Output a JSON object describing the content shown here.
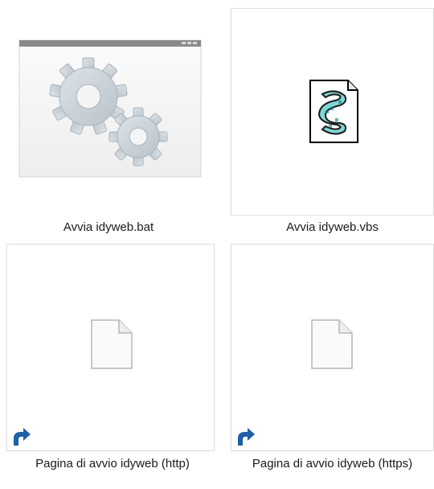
{
  "files": [
    {
      "name": "Avvia idyweb.bat",
      "icon": "batch-file-gears-icon"
    },
    {
      "name": "Avvia idyweb.vbs",
      "icon": "vbscript-file-icon"
    },
    {
      "name": "Pagina di avvio idyweb (http)",
      "icon": "blank-document-icon",
      "overlay": "shortcut-arrow-icon"
    },
    {
      "name": "Pagina di avvio idyweb (https)",
      "icon": "blank-document-icon",
      "overlay": "shortcut-arrow-icon"
    }
  ],
  "colors": {
    "shortcut_arrow": "#1f5fa8",
    "gear": "#c7cfd6",
    "window_titlebar": "#8a8a8a"
  }
}
